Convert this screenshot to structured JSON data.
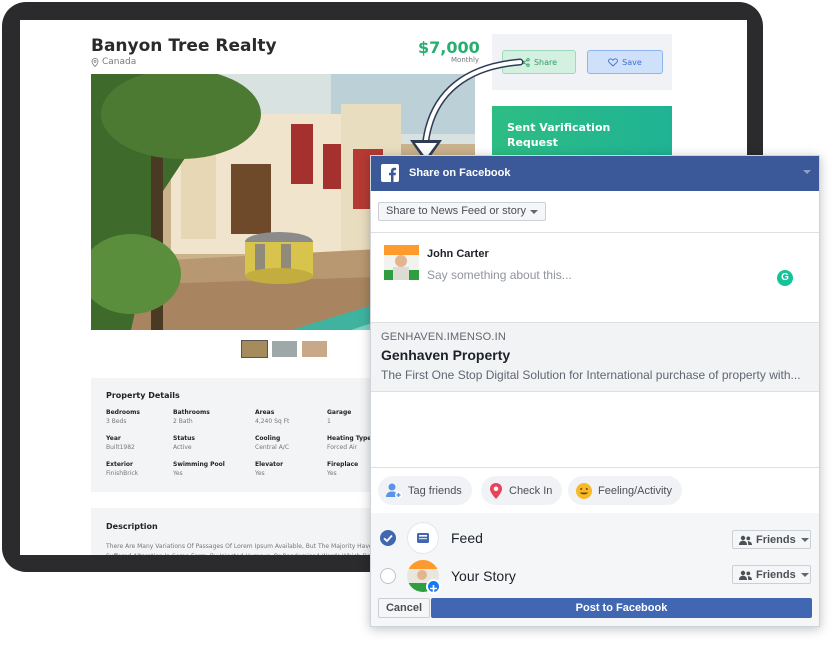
{
  "listing": {
    "title": "Banyon Tree Realty",
    "location": "Canada",
    "price": "$7,000",
    "price_period": "Monthly",
    "share_label": "Share",
    "save_label": "Save",
    "verify_label": "Sent Varification Request"
  },
  "details": {
    "heading": "Property Details",
    "fields": [
      {
        "label": "Bedrooms",
        "value": "3 Beds"
      },
      {
        "label": "Bathrooms",
        "value": "2 Bath"
      },
      {
        "label": "Areas",
        "value": "4,240 Sq Ft"
      },
      {
        "label": "Garage",
        "value": "1"
      },
      {
        "label": "Year",
        "value": "Built1982"
      },
      {
        "label": "Status",
        "value": "Active"
      },
      {
        "label": "Cooling",
        "value": "Central A/C"
      },
      {
        "label": "Heating Type",
        "value": "Forced Air"
      },
      {
        "label": "Exterior",
        "value": "FinishBrick"
      },
      {
        "label": "Swimming Pool",
        "value": "Yes"
      },
      {
        "label": "Elevator",
        "value": "Yes"
      },
      {
        "label": "Fireplace",
        "value": "Yes"
      }
    ]
  },
  "description": {
    "heading": "Description",
    "text": "There Are Many Variations Of Passages Of Lorem Ipsum Available, But The Majority Have Suffered Alteration In Some Form, By Injected Humour, Or Randomised Words Which Don't Look Even"
  },
  "fb": {
    "header_title": "Share on Facebook",
    "share_target": "Share to News Feed or story",
    "user_name": "John Carter",
    "composer_placeholder": "Say something about this...",
    "link_domain": "GENHAVEN.IMENSO.IN",
    "link_title": "Genhaven Property",
    "link_description": "The First One Stop Digital Solution for International purchase of property with...",
    "chips": {
      "tag": "Tag friends",
      "checkin": "Check In",
      "feeling": "Feeling/Activity"
    },
    "feed_label": "Feed",
    "story_label": "Your Story",
    "audience": "Friends",
    "cancel_label": "Cancel",
    "post_label": "Post to Facebook"
  },
  "colors": {
    "facebook_blue": "#3b5998",
    "button_blue": "#4267b2",
    "price_green": "#27ae73"
  }
}
